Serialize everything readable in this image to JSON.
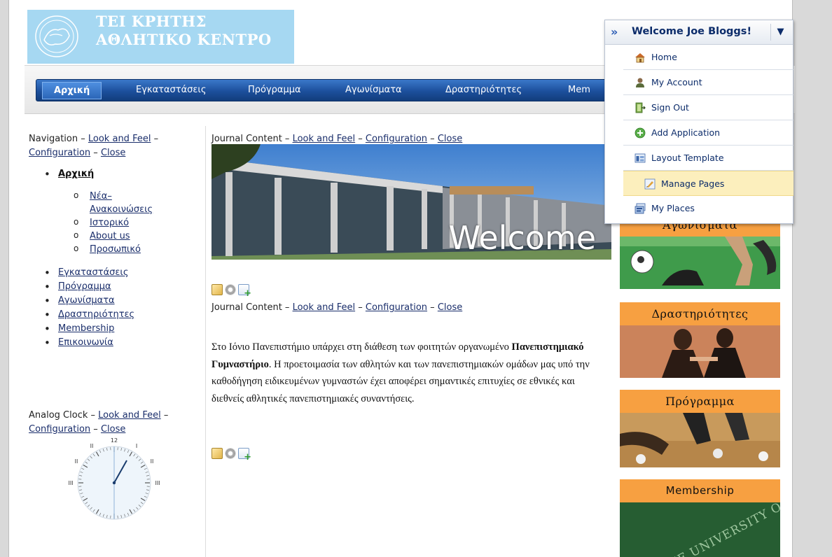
{
  "logo": {
    "line1": "ΤΕΙ ΚΡΗΤΗΣ",
    "line2": "ΑΘΛΗΤΙΚΟ ΚΕΝΤΡΟ"
  },
  "nav": {
    "items": [
      "Αρχική",
      "Εγκαταστάσεις",
      "Πρόγραμμα",
      "Αγωνίσματα",
      "Δραστηριότητες",
      "Mem"
    ]
  },
  "navigation_portlet": {
    "title": "Navigation",
    "sep": " – ",
    "look_and_feel": "Look and Feel",
    "configuration": "Configuration",
    "close": "Close",
    "tree": {
      "home": "Αρχική",
      "children": [
        "Νέα–",
        "Ανακοινώσεις",
        "Ιστορικό",
        "About us",
        "Προσωπικό"
      ],
      "items": [
        "Εγκαταστάσεις",
        "Πρόγραμμα",
        "Αγωνίσματα",
        "Δραστηριότητες",
        "Membership",
        "Επικοινωνία"
      ]
    }
  },
  "clock_portlet": {
    "title": "Analog Clock",
    "look_and_feel": "Look and Feel",
    "configuration": "Configuration",
    "close": "Close",
    "numerals": {
      "n12": "12",
      "n1": "I",
      "n2": "II",
      "n3": "III",
      "n9": "III",
      "n10": "II",
      "n11": "II"
    }
  },
  "journal1": {
    "title": "Journal Content",
    "look_and_feel": "Look and Feel",
    "configuration": "Configuration",
    "close": "Close",
    "banner_text": "Welcome"
  },
  "journal2": {
    "title": "Journal Content",
    "look_and_feel": "Look and Feel",
    "configuration": "Configuration",
    "close": "Close",
    "para_part1": "Στο Ιόνιο Πανεπιστήμιο υπάρχει στη διάθεση των φοιτητών οργανωμένο ",
    "para_bold": "Πανεπιστημιακό Γυμναστήριο",
    "para_part2": ". Η προετοιμασία των αθλητών και των πανεπιστημιακών ομάδων μας υπό την καθοδήγηση ειδικευμένων γυμναστών έχει αποφέρει σημαντικές επιτυχίες σε εθνικές και διεθνείς αθλητικές πανεπιστημιακές συναντήσεις."
  },
  "right_panels": {
    "p1": "Αγωνίσματα",
    "p2": "Δραστηριότητες",
    "p3": "Πρόγραμμα",
    "p4": "Membership",
    "p4_img_text": "THE UNIVERSITY OF MELBOURNE"
  },
  "dock": {
    "welcome": "Welcome Joe Bloggs!",
    "arrows": "»",
    "caret": "▼",
    "menu": {
      "home": "Home",
      "my_account": "My Account",
      "sign_out": "Sign Out",
      "add_application": "Add Application",
      "layout_template": "Layout Template",
      "manage_pages": "Manage Pages",
      "my_places": "My Places"
    }
  }
}
